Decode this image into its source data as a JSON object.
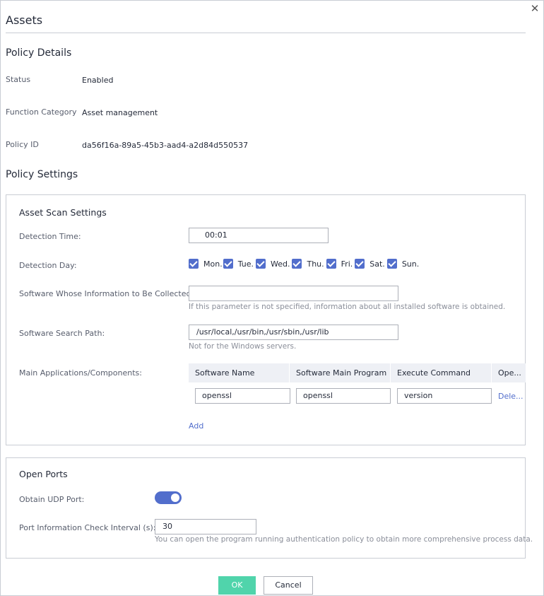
{
  "dialog": {
    "title": "Assets",
    "close_glyph": "✕"
  },
  "policy_details": {
    "heading": "Policy Details",
    "rows": [
      {
        "label": "Status",
        "value": "Enabled"
      },
      {
        "label": "Function Category",
        "value": "Asset management"
      },
      {
        "label": "Policy ID",
        "value": "da56f16a-89a5-45b3-aad4-a2d84d550537"
      }
    ]
  },
  "policy_settings": {
    "heading": "Policy Settings"
  },
  "asset_scan": {
    "heading": "Asset Scan Settings",
    "detection_time": {
      "label": "Detection Time:",
      "value": "00:01"
    },
    "detection_day": {
      "label": "Detection Day:",
      "days": [
        {
          "label": "Mon.",
          "checked": true
        },
        {
          "label": "Tue.",
          "checked": true
        },
        {
          "label": "Wed.",
          "checked": true
        },
        {
          "label": "Thu.",
          "checked": true
        },
        {
          "label": "Fri.",
          "checked": true
        },
        {
          "label": "Sat.",
          "checked": true
        },
        {
          "label": "Sun.",
          "checked": true
        }
      ]
    },
    "software_collect": {
      "label": "Software Whose Information to Be Collected:",
      "value": "",
      "hint": "If this parameter is not specified, information about all installed software is obtained."
    },
    "search_path": {
      "label": "Software Search Path:",
      "value": "/usr/local,/usr/bin,/usr/sbin,/usr/lib",
      "hint": "Not for the Windows servers."
    },
    "main_apps": {
      "label": "Main Applications/Components:",
      "columns": [
        "Software Name",
        "Software Main Program",
        "Execute Command",
        "Ope..."
      ],
      "rows": [
        {
          "name": "openssl",
          "program": "openssl",
          "command": "version",
          "action": "Dele..."
        }
      ],
      "add_label": "Add"
    }
  },
  "open_ports": {
    "heading": "Open Ports",
    "udp": {
      "label": "Obtain UDP Port:",
      "enabled": true
    },
    "interval": {
      "label": "Port Information Check Interval (s):",
      "value": "30",
      "hint": "You can open the program running authentication policy to obtain more comprehensive process data."
    }
  },
  "footer": {
    "ok_label": "OK",
    "cancel_label": "Cancel"
  },
  "colors": {
    "accent": "#526ecc",
    "ok_button": "#50d4ab",
    "border": "#c9cdd4"
  }
}
